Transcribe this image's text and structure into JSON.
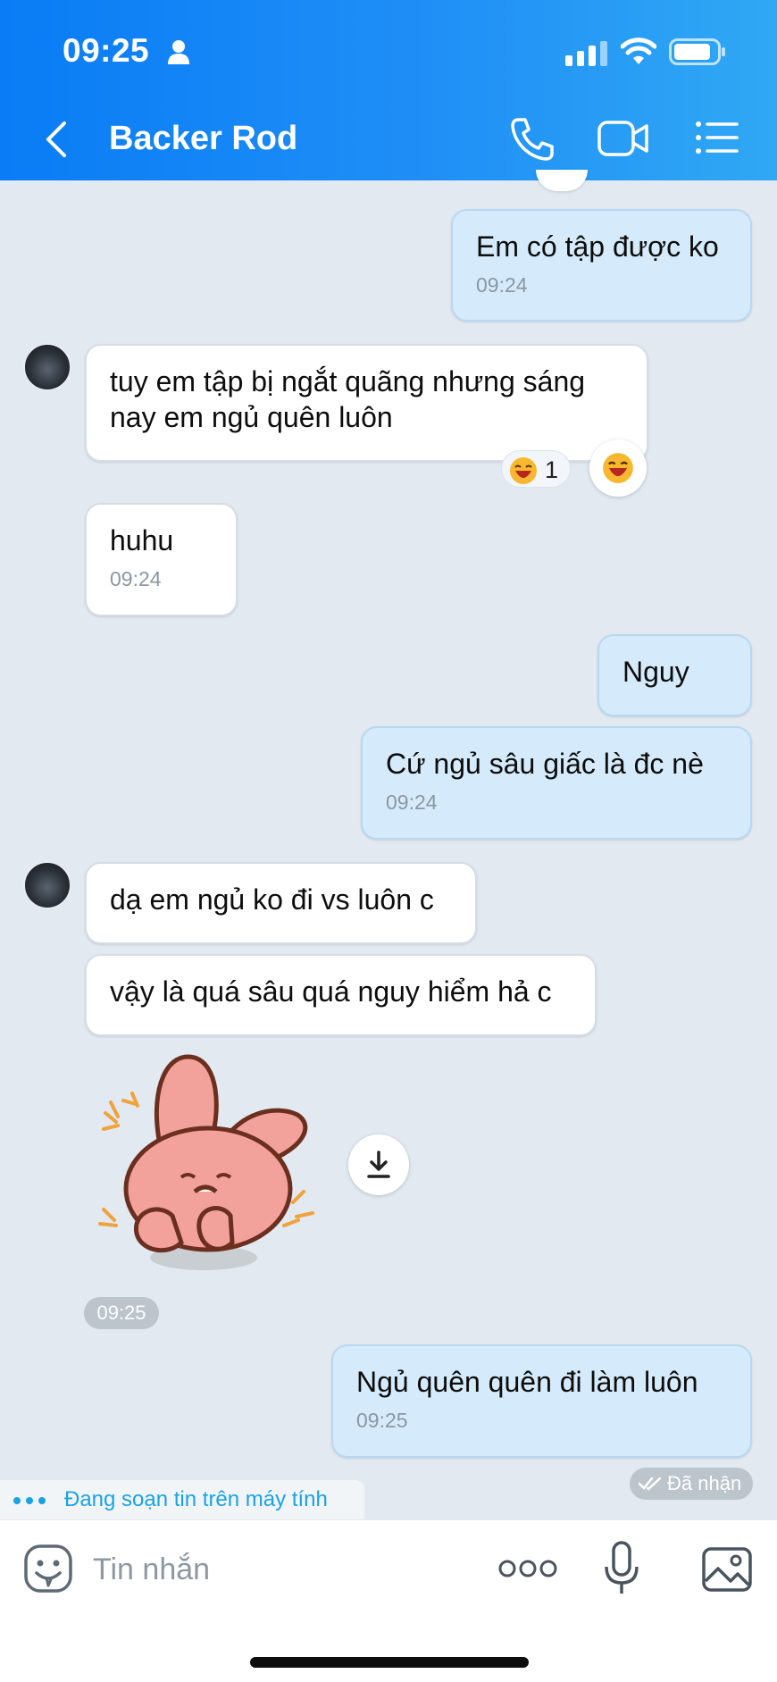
{
  "status_bar": {
    "time": "09:25"
  },
  "header": {
    "title": "Backer Rod"
  },
  "messages": [
    {
      "text": "Em có tập được ko",
      "time": "09:24"
    },
    {
      "text": "tuy em tập bị ngắt quãng nhưng sáng nay em ngủ quên luôn",
      "reaction_count": "1"
    },
    {
      "text": "huhu",
      "time": "09:24"
    },
    {
      "text": "Nguy"
    },
    {
      "text": "Cứ ngủ sâu giấc là đc nè",
      "time": "09:24"
    },
    {
      "text": "dạ em ngủ ko đi vs luôn c"
    },
    {
      "text": "vậy là quá sâu quá nguy hiểm hả c"
    },
    {
      "sticker": "pink-rabbit-sticker",
      "time": "09:25"
    },
    {
      "text": "Ngủ quên quên đi làm luôn",
      "time": "09:25"
    }
  ],
  "received_status": "Đã nhận",
  "typing_indicator": "Đang soạn tin trên máy tính",
  "composer": {
    "placeholder": "Tin nhắn"
  },
  "colors": {
    "header_gradient_start": "#0a7cf5",
    "header_gradient_end": "#30a8f4",
    "outgoing_bubble": "#d5ebfc",
    "incoming_bubble": "#ffffff",
    "chat_background": "#e2e9f1",
    "typing_text": "#1aa2e6"
  },
  "icons": [
    "person-icon",
    "signal-icon",
    "wifi-icon",
    "battery-icon",
    "back-icon",
    "call-icon",
    "video-call-icon",
    "menu-icon",
    "laughing-face-icon",
    "download-icon",
    "double-check-icon",
    "emoji-icon",
    "more-icon",
    "mic-icon",
    "image-icon"
  ]
}
